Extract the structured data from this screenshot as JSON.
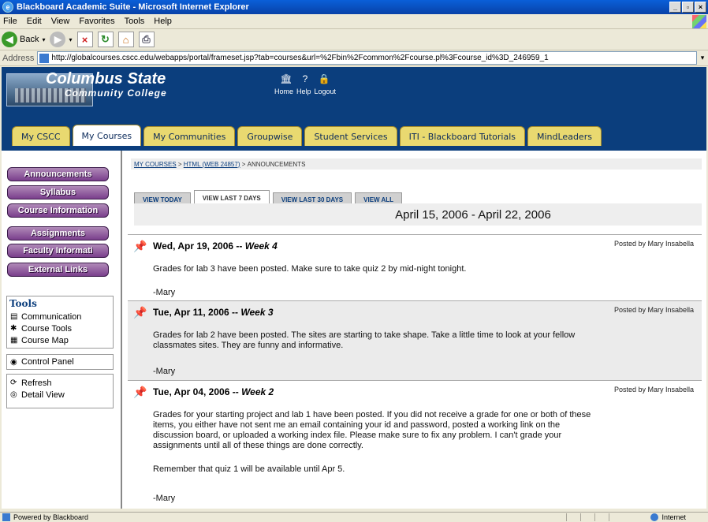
{
  "window": {
    "title": "Blackboard Academic Suite - Microsoft Internet Explorer"
  },
  "menu": [
    "File",
    "Edit",
    "View",
    "Favorites",
    "Tools",
    "Help"
  ],
  "toolbar": {
    "back_label": "Back"
  },
  "address": {
    "label": "Address",
    "url": "http://globalcourses.cscc.edu/webapps/portal/frameset.jsp?tab=courses&url=%2Fbin%2Fcommon%2Fcourse.pl%3Fcourse_id%3D_246959_1"
  },
  "banner": {
    "school": "Columbus State",
    "college": "Community College",
    "links": [
      "Home",
      "Help",
      "Logout"
    ]
  },
  "tabs": [
    "My CSCC",
    "My Courses",
    "My Communities",
    "Groupwise",
    "Student Services",
    "ITI - Blackboard Tutorials",
    "MindLeaders"
  ],
  "active_tab": "My Courses",
  "nav_buttons": [
    "Announcements",
    "Syllabus",
    "Course Information",
    "Assignments",
    "Faculty Informati",
    "External Links"
  ],
  "tools": {
    "title": "Tools",
    "items": [
      "Communication",
      "Course Tools",
      "Course Map"
    ]
  },
  "control_panel": "Control Panel",
  "utilities": [
    "Refresh",
    "Detail View"
  ],
  "breadcrumb": {
    "part1": "MY COURSES",
    "sep": " > ",
    "part2": "HTML (WEB 24857)",
    "part3": "ANNOUNCEMENTS"
  },
  "view_tabs": [
    "VIEW TODAY",
    "VIEW LAST 7 DAYS",
    "VIEW LAST 30 DAYS",
    "VIEW ALL"
  ],
  "active_view_tab": "VIEW LAST 7 DAYS",
  "date_range": "April 15, 2006 - April 22, 2006",
  "announcements": [
    {
      "date": "Wed, Apr 19, 2006",
      "week": "Week 4",
      "posted": "Posted by Mary Insabella",
      "paragraphs": [
        "Grades for lab 3 have been posted.  Make sure to take quiz 2 by mid-night tonight.",
        "-Mary"
      ]
    },
    {
      "date": "Tue, Apr 11, 2006",
      "week": "Week 3",
      "posted": "Posted by Mary Insabella",
      "paragraphs": [
        "Grades for lab 2 have been posted.  The sites are starting to take shape.  Take a little time to look at your fellow classmates sites.  They are funny and informative.",
        "-Mary"
      ]
    },
    {
      "date": "Tue, Apr 04, 2006",
      "week": "Week 2",
      "posted": "Posted by Mary Insabella",
      "paragraphs": [
        "Grades for your starting project and lab 1 have been posted.  If you did not receive a grade for one or both of these items, you either have not sent me an email containing your id and password, posted a working link on the discussion board, or uploaded a working index file.  Please make sure to fix any problem.  I can't grade your assignments until all of these things are done correctly.",
        "Remember that quiz 1 will be available until Apr 5.",
        "-Mary"
      ]
    }
  ],
  "status": {
    "left": "Powered by Blackboard",
    "zone": "Internet"
  }
}
